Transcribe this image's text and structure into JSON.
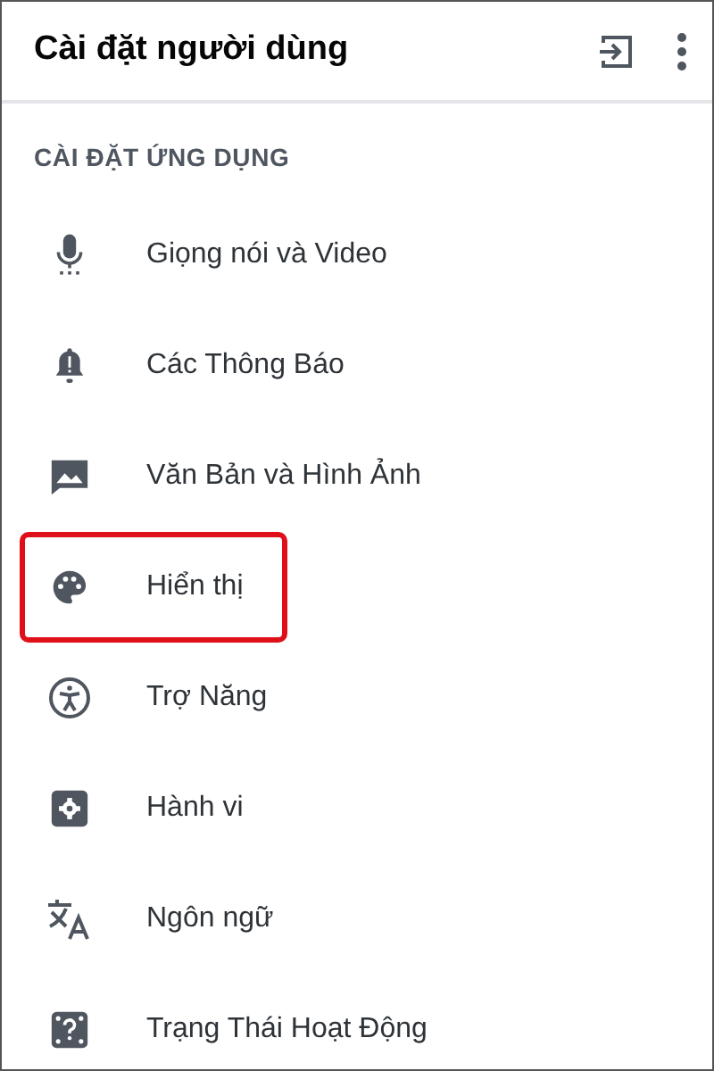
{
  "header": {
    "title": "Cài đặt người dùng"
  },
  "section": {
    "title": "CÀI ĐẶT ỨNG DỤNG"
  },
  "items": [
    {
      "label": "Giọng nói và Video",
      "highlighted": false
    },
    {
      "label": "Các Thông Báo",
      "highlighted": false
    },
    {
      "label": "Văn Bản và Hình Ảnh",
      "highlighted": false
    },
    {
      "label": "Hiển thị",
      "highlighted": true
    },
    {
      "label": "Trợ Năng",
      "highlighted": false
    },
    {
      "label": "Hành vi",
      "highlighted": false
    },
    {
      "label": "Ngôn ngữ",
      "highlighted": false
    },
    {
      "label": "Trạng Thái Hoạt Động",
      "highlighted": false
    }
  ]
}
